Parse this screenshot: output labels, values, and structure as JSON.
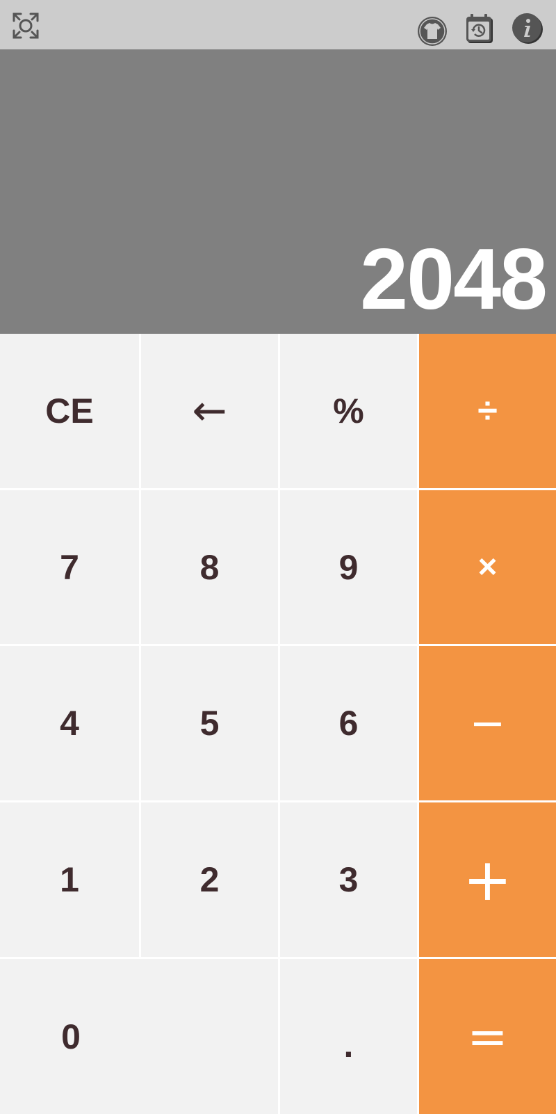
{
  "toolbar": {
    "icons": [
      "fullscreen-icon",
      "tshirt-theme-icon",
      "history-icon",
      "info-icon"
    ],
    "icon_color": "#555555"
  },
  "display": {
    "value": "2048",
    "background": "#808080",
    "text_color": "#ffffff"
  },
  "keypad": {
    "function_key_color": "#f2f2f2",
    "operator_key_color": "#f39442",
    "digit_text_color": "#3f2b2e",
    "rows": [
      [
        "CE",
        "←",
        "%",
        "÷"
      ],
      [
        "7",
        "8",
        "9",
        "×"
      ],
      [
        "4",
        "5",
        "6",
        "−"
      ],
      [
        "1",
        "2",
        "3",
        "+"
      ],
      [
        "0",
        ".",
        "="
      ]
    ]
  }
}
